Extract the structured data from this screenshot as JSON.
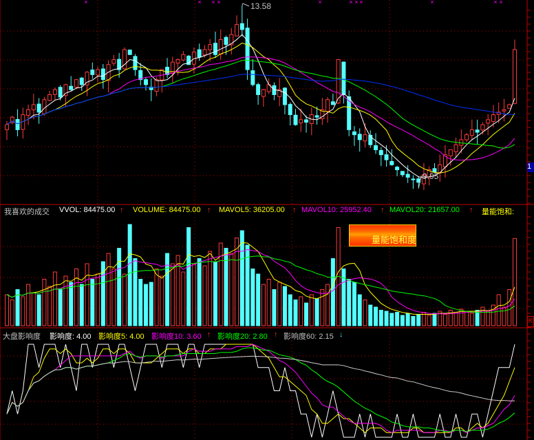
{
  "colors": {
    "up": "#ff3c3c",
    "down": "#54ffff",
    "grid": "#c00000",
    "ma5": "#ffffff",
    "ma10": "#ffff00",
    "ma20": "#ff00ff",
    "ma30": "#00ff00",
    "ma60": "#0030ff"
  },
  "main": {
    "high_label": "13.58",
    "low_label": "9.95",
    "right_tag": "1",
    "top_marks": "×"
  },
  "volume_header": {
    "title": "我喜欢的成交",
    "vvol": "VVOL: 84475.00",
    "volume": "VOLUME: 84475.00",
    "mavol5": "MAVOL5: 36205.00",
    "mavol10": "MAVOL10: 25952.40",
    "mavol20": "MAVOL20: 21657.00",
    "saturation": "量能饱和:",
    "arrow": "↑"
  },
  "saturation_box": {
    "label": "量能饱和度"
  },
  "impact_header": {
    "title": "大盘影响度",
    "v": "影响度: 4.00",
    "ma5": "影响度5: 4.00",
    "ma10": "影响度10: 3.60",
    "ma20": "影响度20: 2.80",
    "ma60": "影响度60: 2.15",
    "arrow_up": "↑",
    "arrow_down": "↓"
  },
  "x_box": "X",
  "chart_data": {
    "type": "candlestick",
    "price_range": [
      9.95,
      13.58
    ],
    "closes": [
      11.2,
      11.35,
      11.1,
      11.4,
      11.5,
      11.6,
      11.45,
      11.7,
      11.8,
      11.9,
      11.75,
      12.0,
      11.9,
      12.1,
      12.0,
      12.25,
      12.2,
      12.3,
      12.1,
      12.4,
      12.5,
      12.3,
      12.7,
      12.6,
      12.3,
      12.1,
      12.0,
      11.9,
      12.1,
      12.3,
      12.2,
      12.45,
      12.5,
      12.6,
      12.4,
      12.65,
      12.55,
      12.7,
      12.8,
      12.6,
      12.9,
      12.8,
      13.0,
      13.2,
      13.1,
      12.3,
      12.0,
      11.8,
      11.9,
      12.0,
      11.8,
      11.9,
      11.6,
      11.4,
      11.2,
      11.3,
      11.25,
      11.4,
      11.35,
      11.5,
      11.7,
      11.6,
      12.5,
      11.8,
      11.1,
      11.0,
      10.9,
      11.0,
      10.8,
      10.7,
      10.6,
      10.5,
      10.4,
      10.3,
      10.2,
      10.15,
      10.1,
      10.05,
      10.2,
      10.3,
      10.25,
      10.4,
      10.6,
      10.7,
      10.8,
      10.9,
      11.0,
      11.1,
      11.05,
      11.2,
      11.3,
      11.4,
      11.45,
      11.5,
      11.6,
      12.7
    ],
    "volumes": [
      30000,
      25000,
      35000,
      28000,
      40000,
      32000,
      30000,
      45000,
      38000,
      52000,
      35000,
      48000,
      42000,
      55000,
      40000,
      60000,
      45000,
      50000,
      62000,
      70000,
      55000,
      75000,
      50000,
      98000,
      65000,
      45000,
      40000,
      42000,
      55000,
      48000,
      70000,
      60000,
      68000,
      52000,
      95000,
      60000,
      65000,
      58000,
      72000,
      62000,
      80000,
      75000,
      70000,
      85000,
      92000,
      78000,
      55000,
      50000,
      40000,
      45000,
      35000,
      42000,
      38000,
      30000,
      25000,
      28000,
      22000,
      30000,
      26000,
      35000,
      40000,
      65000,
      95000,
      55000,
      45000,
      42000,
      30000,
      25000,
      20000,
      18000,
      15000,
      14000,
      12000,
      13000,
      10000,
      12000,
      9000,
      11000,
      13000,
      10000,
      12000,
      14000,
      11000,
      15000,
      13000,
      16000,
      14000,
      12000,
      15000,
      18000,
      14000,
      20000,
      30000,
      18000,
      35000,
      84475
    ],
    "volume_range": [
      0,
      100000
    ],
    "impact": [
      1,
      2,
      1,
      2,
      4,
      4,
      3,
      4,
      4,
      4,
      3,
      4,
      3,
      2,
      4,
      4,
      3,
      4,
      4,
      4,
      3,
      4,
      4,
      3,
      2,
      3,
      4,
      4,
      4,
      3,
      4,
      4,
      4,
      3,
      4,
      4,
      3,
      4,
      4,
      4,
      4,
      4,
      4,
      4,
      4,
      4,
      4,
      3,
      3,
      3,
      2,
      2,
      3,
      2,
      2,
      1,
      1,
      0,
      1,
      0,
      1,
      2,
      1,
      0,
      0,
      0,
      1,
      0,
      1,
      0,
      0,
      0,
      0,
      1,
      0,
      0,
      1,
      0,
      0,
      0,
      0,
      1,
      0,
      0,
      1,
      0,
      0,
      1,
      1,
      0,
      1,
      2,
      3,
      3,
      3,
      4
    ],
    "impact_range": [
      0,
      4
    ],
    "price_ma_periods": [
      5,
      10,
      20,
      30,
      60
    ],
    "volume_ma_periods": [
      5,
      10,
      20
    ],
    "impact_ma_periods": [
      5,
      10,
      20,
      60
    ]
  }
}
